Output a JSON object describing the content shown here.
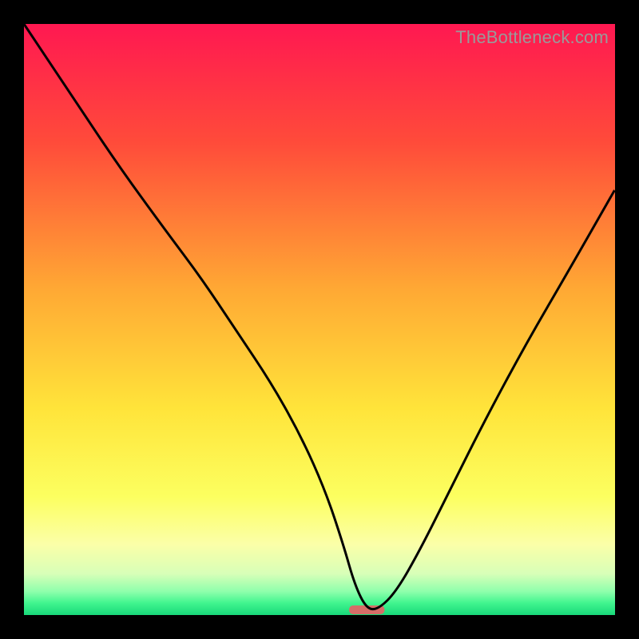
{
  "watermark": "TheBottleneck.com",
  "chart_data": {
    "type": "line",
    "title": "",
    "xlabel": "",
    "ylabel": "",
    "xlim": [
      0,
      100
    ],
    "ylim": [
      0,
      100
    ],
    "grid": false,
    "legend": false,
    "gradient_stops": [
      {
        "offset": 0,
        "color": "#ff1851"
      },
      {
        "offset": 20,
        "color": "#ff4b3a"
      },
      {
        "offset": 45,
        "color": "#ffa934"
      },
      {
        "offset": 65,
        "color": "#ffe43a"
      },
      {
        "offset": 80,
        "color": "#fcff60"
      },
      {
        "offset": 88,
        "color": "#fbffa8"
      },
      {
        "offset": 93,
        "color": "#d8ffb8"
      },
      {
        "offset": 96,
        "color": "#8fffac"
      },
      {
        "offset": 98,
        "color": "#40f58e"
      },
      {
        "offset": 100,
        "color": "#19d87a"
      }
    ],
    "series": [
      {
        "name": "bottleneck-curve",
        "x": [
          0,
          8,
          16,
          24,
          30,
          36,
          42,
          47,
          51,
          54,
          56,
          58,
          60,
          63,
          67,
          72,
          78,
          85,
          92,
          100
        ],
        "y": [
          100,
          88,
          76,
          65,
          57,
          48,
          39,
          30,
          21,
          12,
          5,
          1,
          1,
          4,
          11,
          21,
          33,
          46,
          58,
          72
        ]
      }
    ],
    "marker": {
      "name": "optimal-point",
      "x": 58,
      "width": 6,
      "color": "#d66e68"
    }
  }
}
